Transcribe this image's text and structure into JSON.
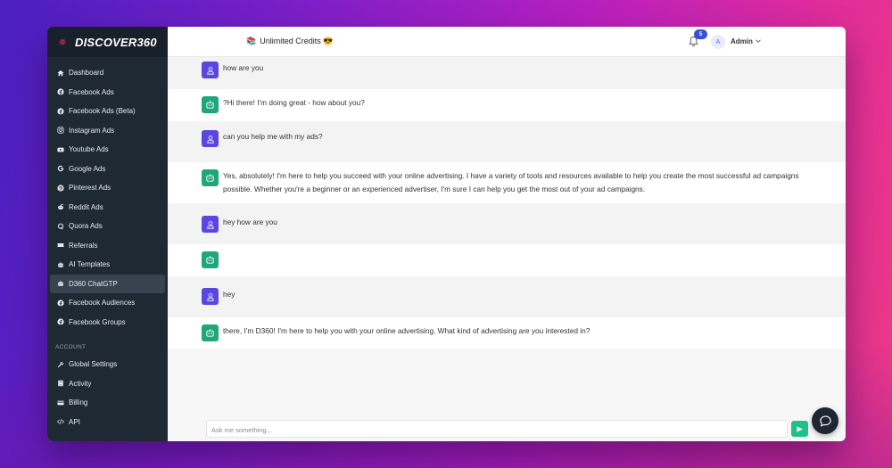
{
  "brand": {
    "name": "DISCOVER360"
  },
  "header": {
    "credits_icon": "📚",
    "credits_label": "Unlimited Credits 😎",
    "notification_count": "5",
    "avatar_initial": "A",
    "user_name": "Admin"
  },
  "sidebar": {
    "items": [
      {
        "label": "Dashboard",
        "icon": "home-icon"
      },
      {
        "label": "Facebook Ads",
        "icon": "facebook-icon"
      },
      {
        "label": "Facebook Ads (Beta)",
        "icon": "facebook-icon"
      },
      {
        "label": "Instagram Ads",
        "icon": "instagram-icon"
      },
      {
        "label": "Youtube Ads",
        "icon": "youtube-icon"
      },
      {
        "label": "Google Ads",
        "icon": "google-icon"
      },
      {
        "label": "Pinterest Ads",
        "icon": "pinterest-icon"
      },
      {
        "label": "Reddit Ads",
        "icon": "reddit-icon"
      },
      {
        "label": "Quora Ads",
        "icon": "quora-icon"
      },
      {
        "label": "Referrals",
        "icon": "ticket-icon"
      },
      {
        "label": "AI Templates",
        "icon": "robot-icon"
      },
      {
        "label": "D360 ChatGTP",
        "icon": "robot-icon",
        "active": true
      },
      {
        "label": "Facebook Audiences",
        "icon": "facebook-icon"
      },
      {
        "label": "Facebook Groups",
        "icon": "facebook-icon"
      }
    ],
    "account_label": "ACCOUNT",
    "account_items": [
      {
        "label": "Global Settings",
        "icon": "wrench-icon"
      },
      {
        "label": "Activity",
        "icon": "book-icon"
      },
      {
        "label": "Billing",
        "icon": "credit-card-icon"
      },
      {
        "label": "API",
        "icon": "code-icon"
      }
    ]
  },
  "chat": {
    "messages": [
      {
        "role": "user",
        "text": "how are you"
      },
      {
        "role": "bot",
        "text": "?Hi there! I'm doing great - how about you?"
      },
      {
        "role": "user",
        "text": "can you help me with my ads?"
      },
      {
        "role": "bot",
        "text": "Yes, absolutely! I'm here to help you succeed with your online advertising. I have a variety of tools and resources available to help you create the most successful ad campaigns possible. Whether you're a beginner or an experienced advertiser, I'm sure I can help you get the most out of your ad campaigns."
      },
      {
        "role": "user",
        "text": "hey how are you"
      },
      {
        "role": "bot",
        "text": ""
      },
      {
        "role": "user",
        "text": "hey"
      },
      {
        "role": "bot",
        "text": " there, I'm D360! I'm here to help you with your online advertising. What kind of advertising are you interested in?"
      }
    ],
    "input_placeholder": "Ask me something..."
  },
  "colors": {
    "sidebar_bg": "#1f2933",
    "user_icon": "#5b47e0",
    "bot_icon": "#1fa67a",
    "send_button": "#20c08b",
    "badge": "#3b4fd6"
  }
}
